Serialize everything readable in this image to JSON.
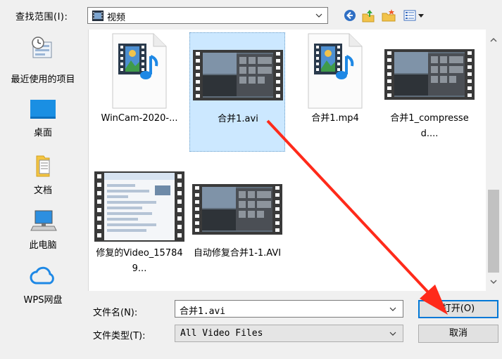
{
  "header": {
    "look_in_label": "查找范围(I):",
    "look_in_value": "视频"
  },
  "toolbar": {
    "back_icon": "back-arrow-icon",
    "up_icon": "up-folder-icon",
    "new_folder_icon": "new-folder-icon",
    "view_icon": "view-menu-icon"
  },
  "places": [
    {
      "label": "最近使用的项目",
      "icon": "recent-items-icon"
    },
    {
      "label": "桌面",
      "icon": "desktop-icon"
    },
    {
      "label": "文档",
      "icon": "documents-icon"
    },
    {
      "label": "此电脑",
      "icon": "computer-icon"
    },
    {
      "label": "WPS网盘",
      "icon": "wps-cloud-icon"
    }
  ],
  "files": [
    {
      "name": "WinCam-2020-...",
      "type": "media-file",
      "selected": false
    },
    {
      "name": "合并1.avi",
      "type": "video-thumb",
      "selected": true
    },
    {
      "name": "合并1.mp4",
      "type": "media-file",
      "selected": false
    },
    {
      "name": "合并1_compressed....",
      "type": "video-thumb",
      "selected": false
    },
    {
      "name": "修复的Video_157849...",
      "type": "video-thumb",
      "selected": false
    },
    {
      "name": "自动修复合并1-1.AVI",
      "type": "video-thumb",
      "selected": false
    }
  ],
  "filename": {
    "label": "文件名(N):",
    "value": "合并1.avi"
  },
  "filetype": {
    "label": "文件类型(T):",
    "value": "All Video Files"
  },
  "buttons": {
    "open": "打开(O)",
    "cancel": "取消"
  },
  "colors": {
    "accent": "#0078d7",
    "selection": "#cce8ff",
    "annotation_arrow": "#ff2a1a"
  }
}
